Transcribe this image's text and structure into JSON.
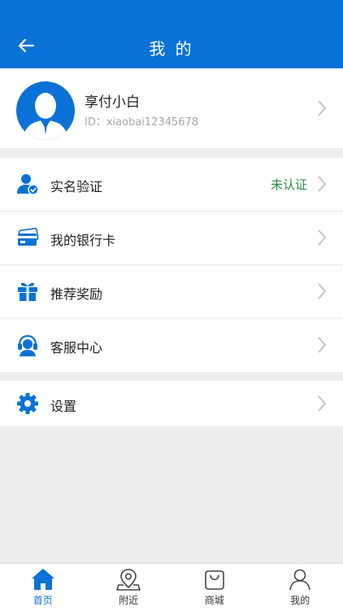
{
  "header": {
    "title": "我 的"
  },
  "profile": {
    "name": "享付小白",
    "id_text": "ID：xiaobai12345678"
  },
  "menu": {
    "verify": {
      "label": "实名验证",
      "status": "未认证"
    },
    "bank_card": {
      "label": "我的银行卡"
    },
    "rewards": {
      "label": "推荐奖励"
    },
    "service": {
      "label": "客服中心"
    },
    "settings": {
      "label": "设置"
    }
  },
  "tabs": [
    {
      "label": "首页",
      "icon": "home-icon",
      "active": true
    },
    {
      "label": "附近",
      "icon": "location-icon"
    },
    {
      "label": "商城",
      "icon": "shopping-bag-icon"
    },
    {
      "label": "我的",
      "icon": "user-icon"
    }
  ],
  "colors": {
    "accent": "#0a72d6",
    "status_green": "#2b8a3e",
    "background": "#ededed"
  }
}
